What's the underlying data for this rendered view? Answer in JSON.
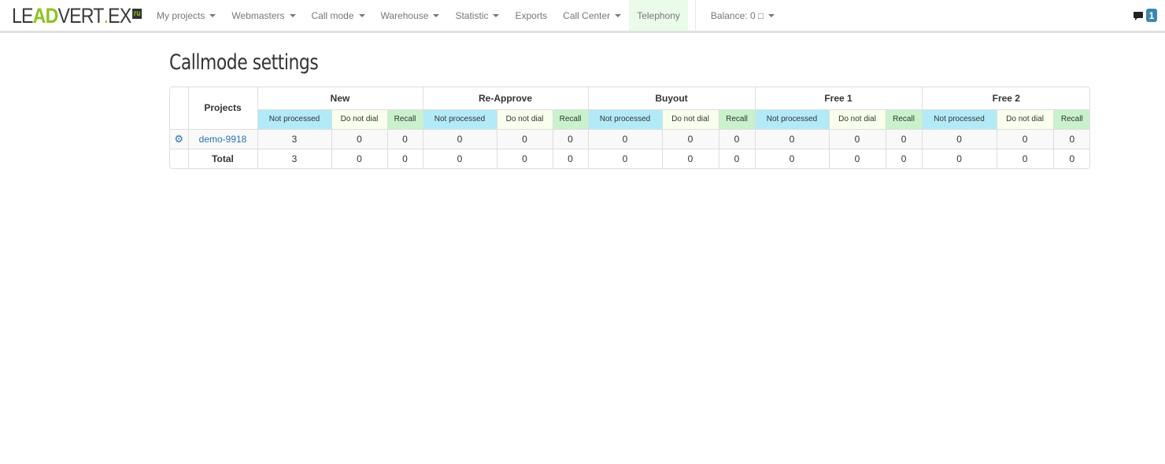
{
  "navbar": {
    "logo": {
      "le": "LE",
      "ad": "AD",
      "vert": "VERT",
      "dot": ".",
      "ex": "EX",
      "ru": "ru"
    },
    "items": [
      {
        "label": "My projects",
        "dropdown": true
      },
      {
        "label": "Webmasters",
        "dropdown": true
      },
      {
        "label": "Call mode",
        "dropdown": true
      },
      {
        "label": "Warehouse",
        "dropdown": true
      },
      {
        "label": "Statistic",
        "dropdown": true
      },
      {
        "label": "Exports",
        "dropdown": false
      },
      {
        "label": "Call Center",
        "dropdown": true
      },
      {
        "label": "Telephony",
        "dropdown": false,
        "highlighted": true
      }
    ],
    "balance_label": "Balance: 0 □",
    "messages_count": "1"
  },
  "page": {
    "title": "Callmode settings"
  },
  "table": {
    "projects_header": "Projects",
    "groups": [
      "New",
      "Re-Approve",
      "Buyout",
      "Free 1",
      "Free 2"
    ],
    "subcolumns": [
      "Not processed",
      "Do not dial",
      "Recall"
    ],
    "rows": [
      {
        "project": "demo-9918",
        "has_settings_icon": true,
        "values": [
          "3",
          "0",
          "0",
          "0",
          "0",
          "0",
          "0",
          "0",
          "0",
          "0",
          "0",
          "0",
          "0",
          "0",
          "0"
        ]
      }
    ],
    "total": {
      "label": "Total",
      "values": [
        "3",
        "0",
        "0",
        "0",
        "0",
        "0",
        "0",
        "0",
        "0",
        "0",
        "0",
        "0",
        "0",
        "0",
        "0"
      ]
    }
  },
  "colors": {
    "not_processed": "#b2ebf7",
    "do_not_dial": "#f8ffec",
    "recall": "#c9f2cc",
    "link": "#2a72b5",
    "telephony_highlight": "#eafbea",
    "badge": "#3a87ad"
  }
}
